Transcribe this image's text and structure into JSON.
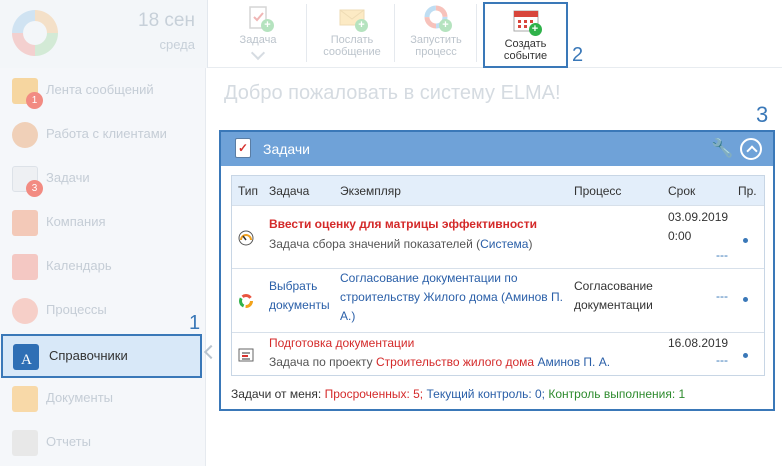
{
  "header": {
    "date_number": "18 сен",
    "date_weekday": "среда",
    "toolbar": [
      {
        "label": "Задача"
      },
      {
        "label": "Послать сообщение"
      },
      {
        "label": "Запустить процесс"
      },
      {
        "label": "Создать событие"
      }
    ]
  },
  "callouts": {
    "one": "1",
    "two": "2",
    "three": "3"
  },
  "sidebar": {
    "items": [
      {
        "label": "Лента сообщений",
        "badge": "1"
      },
      {
        "label": "Работа с клиентами"
      },
      {
        "label": "Задачи",
        "badge": "3"
      },
      {
        "label": "Компания"
      },
      {
        "label": "Календарь"
      },
      {
        "label": "Процессы"
      },
      {
        "label": "Справочники"
      },
      {
        "label": "Документы"
      },
      {
        "label": "Отчеты"
      }
    ]
  },
  "main": {
    "welcome": "Добро пожаловать в систему ELMA!",
    "portlet": {
      "title": "Задачи",
      "columns": [
        "Тип",
        "Задача",
        "Экземпляр",
        "Процесс",
        "Срок",
        "Пр."
      ],
      "rows": [
        {
          "task": "Ввести оценку для матрицы эффективности",
          "subtitle_prefix": "Задача сбора значений показателей (",
          "subtitle_link": "Система",
          "subtitle_suffix": ")",
          "instance": "",
          "process": "",
          "due_date": "03.09.2019",
          "due_time": "0:00",
          "due_extra": "---"
        },
        {
          "task_line1": "Выбрать",
          "task_line2": "документы",
          "instance_line1": "Согласование документации по",
          "instance_line2": "строительству Жилого дома",
          "instance_owner": "(Аминов П.",
          "instance_owner_end": "А.)",
          "process_line1": "Согласование",
          "process_line2": "документации",
          "due": "---"
        },
        {
          "task": "Подготовка документации",
          "subtitle_prefix": "Задача по проекту",
          "subtitle_project": "Строительство жилого дома",
          "subtitle_owner": "Аминов П. А.",
          "due_date": "16.08.2019",
          "due_extra": "---"
        }
      ]
    },
    "summary": {
      "prefix": "Задачи от меня:",
      "overdue": "Просроченных: 5;",
      "current": "Текущий контроль: 0;",
      "control": "Контроль выполнения: 1"
    }
  },
  "colors": {
    "accent": "#3a78b8",
    "portlet_header": "#6fa2d8",
    "overdue": "#d42a2a",
    "control": "#2e8b2e"
  }
}
